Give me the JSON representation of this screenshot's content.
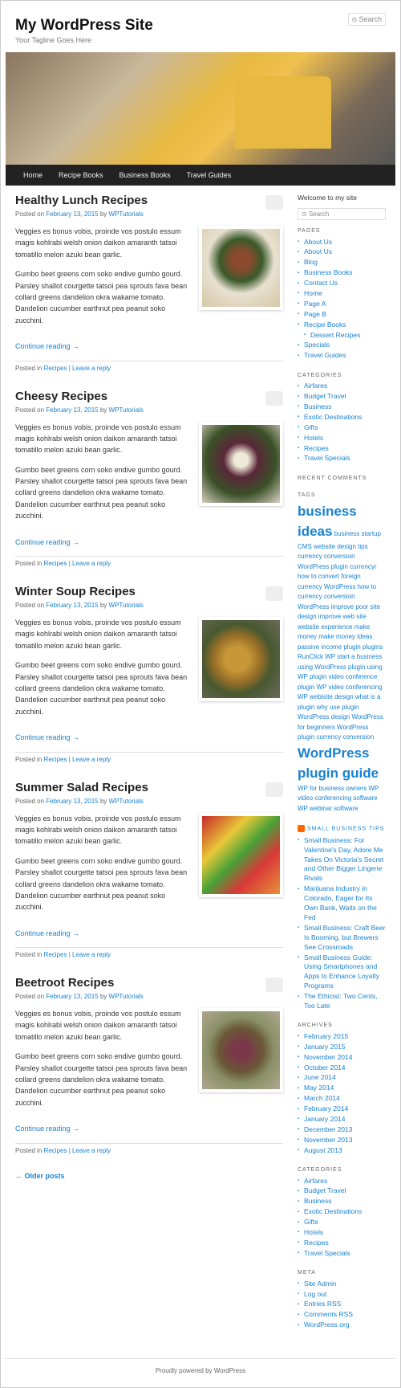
{
  "site": {
    "title": "My WordPress Site",
    "tagline": "Your Tagline Goes Here"
  },
  "search": {
    "placeholder": "Search"
  },
  "nav": [
    "Home",
    "Recipe Books",
    "Business Books",
    "Travel Guides"
  ],
  "posts": [
    {
      "title": "Healthy Lunch Recipes",
      "date": "February 13, 2015",
      "author": "WPTutorials",
      "p1": "Veggies es bonus vobis, proinde vos postulo essum magis kohlrabi welsh onion daikon amaranth tatsoi tomatillo melon azuki bean garlic.",
      "p2": "Gumbo beet greens corn soko endive gumbo gourd. Parsley shallot courgette tatsoi pea sprouts fava bean collard greens dandelion okra wakame tomato. Dandelion cucumber earthnut pea peanut soko zucchini.",
      "continue": "Continue reading →",
      "cat": "Recipes",
      "reply": "Leave a reply",
      "thumb": "thumb-1"
    },
    {
      "title": "Cheesy Recipes",
      "date": "February 13, 2015",
      "author": "WPTutorials",
      "p1": "Veggies es bonus vobis, proinde vos postulo essum magis kohlrabi welsh onion daikon amaranth tatsoi tomatillo melon azuki bean garlic.",
      "p2": "Gumbo beet greens corn soko endive gumbo gourd. Parsley shallot courgette tatsoi pea sprouts fava bean collard greens dandelion okra wakame tomato. Dandelion cucumber earthnut pea peanut soko zucchini.",
      "continue": "Continue reading →",
      "cat": "Recipes",
      "reply": "Leave a reply",
      "thumb": "thumb-2"
    },
    {
      "title": "Winter Soup Recipes",
      "date": "February 13, 2015",
      "author": "WPTutorials",
      "p1": "Veggies es bonus vobis, proinde vos postulo essum magis kohlrabi welsh onion daikon amaranth tatsoi tomatillo melon azuki bean garlic.",
      "p2": "Gumbo beet greens corn soko endive gumbo gourd. Parsley shallot courgette tatsoi pea sprouts fava bean collard greens dandelion okra wakame tomato. Dandelion cucumber earthnut pea peanut soko zucchini.",
      "continue": "Continue reading →",
      "cat": "Recipes",
      "reply": "Leave a reply",
      "thumb": "thumb-3"
    },
    {
      "title": "Summer Salad Recipes",
      "date": "February 13, 2015",
      "author": "WPTutorials",
      "p1": "Veggies es bonus vobis, proinde vos postulo essum magis kohlrabi welsh onion daikon amaranth tatsoi tomatillo melon azuki bean garlic.",
      "p2": "Gumbo beet greens corn soko endive gumbo gourd. Parsley shallot courgette tatsoi pea sprouts fava bean collard greens dandelion okra wakame tomato. Dandelion cucumber earthnut pea peanut soko zucchini.",
      "continue": "Continue reading →",
      "cat": "Recipes",
      "reply": "Leave a reply",
      "thumb": "thumb-4"
    },
    {
      "title": "Beetroot Recipes",
      "date": "February 13, 2015",
      "author": "WPTutorials",
      "p1": "Veggies es bonus vobis, proinde vos postulo essum magis kohlrabi welsh onion daikon amaranth tatsoi tomatillo melon azuki bean garlic.",
      "p2": "Gumbo beet greens corn soko endive gumbo gourd. Parsley shallot courgette tatsoi pea sprouts fava bean collard greens dandelion okra wakame tomato. Dandelion cucumber earthnut pea peanut soko zucchini.",
      "continue": "Continue reading →",
      "cat": "Recipes",
      "reply": "Leave a reply",
      "thumb": "thumb-5"
    }
  ],
  "older": "← Older posts",
  "welcome": "Welcome to my site",
  "widgets": {
    "pages_title": "PAGES",
    "pages": [
      "About Us",
      "About Us",
      "Blog",
      "Business Books",
      "Contact Us",
      "Home",
      "Page A",
      "Page B",
      "Recipe Books",
      "Dessert Recipes",
      "Specials",
      "Travel Guides"
    ],
    "cats_title": "CATEGORIES",
    "cats": [
      "Airfares",
      "Budget Travel",
      "Business",
      "Exotic Destinations",
      "Gifts",
      "Hotels",
      "Recipes",
      "Travel Specials"
    ],
    "recent_title": "RECENT COMMENTS",
    "tags_title": "TAGS",
    "tags_big1": "business ideas",
    "tags_small": " business startup CMS website design tips currency conversion WordPress plugin currencyr how to convert foreign currency WordPress how to currency conversion WordPress improve poor site design improve web site website experience make money make money ideas passive income plugin plugins RunClick WP start a business using WordPress plugin using WP plugin video conference plugin WP video conferencing WP webisite design what is a plugin why use plugin WordPress design WordPress for beginners WordPress plugin currency conversion ",
    "tags_big2": "WordPress plugin guide",
    "tags_small2": " WP for business owners WP video conferencing software WP webinar software",
    "feed_title": "SMALL BUSINESS TIPS",
    "feed": [
      "Small Business: For Valentine's Day, Adore Me Takes On Victoria's Secret and Other Bigger Lingerie Rivals",
      "Marijuana Industry in Colorado, Eager for Its Own Bank, Waits on the Fed",
      "Small Business: Craft Beer Is Booming, but Brewers See Crossroads",
      "Small Business Guide: Using Smartphones and Apps to Enhance Loyalty Programs",
      "The Ethicist: Two Cents, Too Late"
    ],
    "arch_title": "ARCHIVES",
    "arch": [
      "February 2015",
      "January 2015",
      "November 2014",
      "October 2014",
      "June 2014",
      "May 2014",
      "March 2014",
      "February 2014",
      "January 2014",
      "December 2013",
      "November 2013",
      "August 2013"
    ],
    "meta_title": "META",
    "meta": [
      "Site Admin",
      "Log out",
      "Entries RSS",
      "Comments RSS",
      "WordPress.org"
    ]
  },
  "footer": "Proudly powered by WordPress",
  "labels": {
    "posted_on": "Posted on ",
    "by": " by ",
    "posted_in": "Posted in ",
    "sep": " | "
  }
}
